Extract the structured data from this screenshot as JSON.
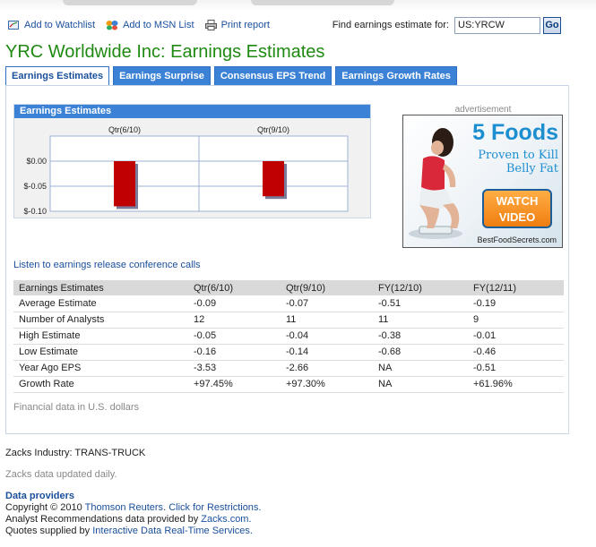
{
  "toolbar": {
    "watchlist": "Add to Watchlist",
    "msn": "Add to MSN List",
    "print": "Print report",
    "find_label": "Find earnings estimate for:",
    "find_value": "US:YRCW",
    "go": "Go"
  },
  "title": "YRC Worldwide Inc: Earnings Estimates",
  "tabs": [
    {
      "label": "Earnings Estimates",
      "active": true
    },
    {
      "label": "Earnings Surprise"
    },
    {
      "label": "Consensus EPS Trend"
    },
    {
      "label": "Earnings Growth Rates"
    }
  ],
  "chart": {
    "title": "Earnings Estimates"
  },
  "chart_data": {
    "type": "bar",
    "title": "Earnings Estimates",
    "categories": [
      "Qtr(6/10)",
      "Qtr(9/10)"
    ],
    "values": [
      -0.09,
      -0.07
    ],
    "y_ticks": [
      "$0.00",
      "$-0.05",
      "$-0.10"
    ],
    "y_tick_values": [
      0,
      -0.05,
      -0.1
    ],
    "ylim": [
      -0.1,
      0.05
    ],
    "grid": true,
    "bar_color": "#c00000"
  },
  "ad": {
    "label": "advertisement",
    "headline": "5 Foods",
    "sub": "Proven to Kill Belly Fat",
    "button": "WATCH VIDEO",
    "site": "BestFoodSecrets.com"
  },
  "listen_link": "Listen to earnings release conference calls",
  "table": {
    "headers": [
      "Earnings Estimates",
      "Qtr(6/10)",
      "Qtr(9/10)",
      "FY(12/10)",
      "FY(12/11)"
    ],
    "rows": [
      [
        "Average Estimate",
        "-0.09",
        "-0.07",
        "-0.51",
        "-0.19"
      ],
      [
        "Number of Analysts",
        "12",
        "11",
        "11",
        "9"
      ],
      [
        "High Estimate",
        "-0.05",
        "-0.04",
        "-0.38",
        "-0.01"
      ],
      [
        "Low Estimate",
        "-0.16",
        "-0.14",
        "-0.68",
        "-0.46"
      ],
      [
        "Year Ago EPS",
        "-3.53",
        "-2.66",
        "NA",
        "-0.51"
      ],
      [
        "Growth Rate",
        "+97.45%",
        "+97.30%",
        "NA",
        "+61.96%"
      ]
    ]
  },
  "fin_note": "Financial data in U.S. dollars",
  "industry": "Zacks Industry: TRANS-TRUCK",
  "updated": "Zacks data updated daily.",
  "providers": {
    "title": "Data providers",
    "copyright_prefix": "Copyright © 2010",
    "thomson": "Thomson Reuters",
    "restrictions": "Click for Restrictions.",
    "analyst_prefix": "Analyst Recommendations data provided by",
    "zacks": "Zacks.com.",
    "quotes_prefix": "Quotes supplied by",
    "interactive": "Interactive Data Real-Time Services."
  },
  "colors": {
    "accent_green": "#1f8a12",
    "tab_blue": "#3b82d6",
    "link_blue": "#1a4f9c",
    "negative_red": "#c00000"
  }
}
